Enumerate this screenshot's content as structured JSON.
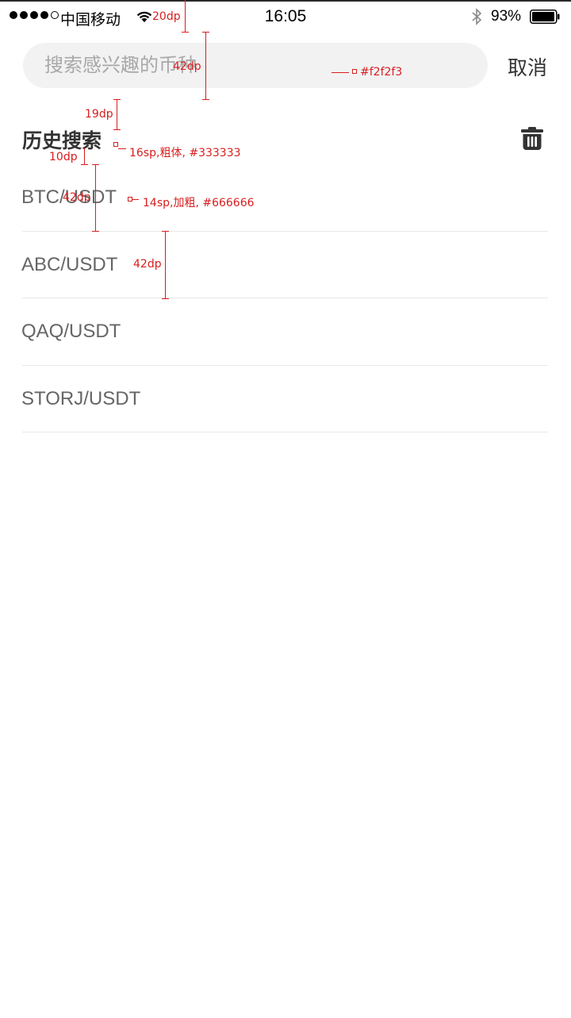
{
  "status_bar": {
    "carrier": "中国移动",
    "time": "16:05",
    "battery": "93%"
  },
  "search": {
    "placeholder": "搜索感兴趣的币种",
    "value": "",
    "cancel_label": "取消",
    "box_color": "#f2f2f3"
  },
  "history": {
    "title": "历史搜索",
    "items": [
      {
        "label": "BTC/USDT"
      },
      {
        "label": "ABC/USDT"
      },
      {
        "label": "QAQ/USDT"
      },
      {
        "label": "STORJ/USDT"
      }
    ],
    "title_color": "#333333",
    "item_color": "#666666"
  },
  "annotations": {
    "status_height": "20dp",
    "search_height": "42dp",
    "search_color": "#f2f2f3",
    "header_gap": "19dp",
    "title_spec": "16sp,粗体, #333333",
    "list_gap": "10dp",
    "item_height_1": "42dp",
    "item_spec": "14sp,加粗, #666666",
    "item_height_2": "42dp"
  }
}
